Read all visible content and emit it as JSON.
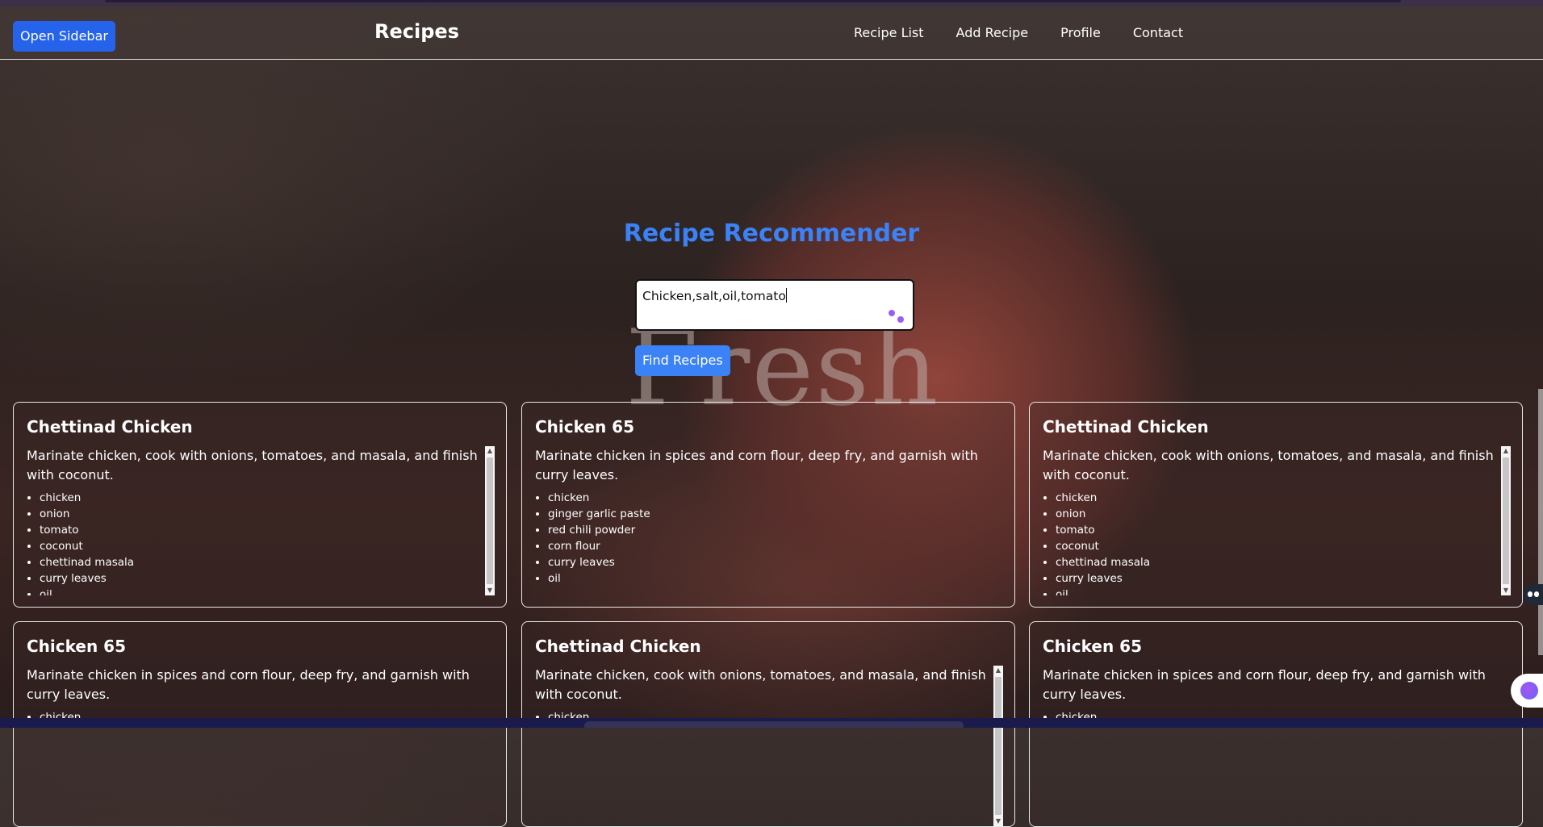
{
  "navbar": {
    "sidebar_button": "Open Sidebar",
    "brand": "Recipes",
    "links": [
      "Recipe List",
      "Add Recipe",
      "Profile",
      "Contact"
    ]
  },
  "hero": {
    "title": "Recipe Recommender",
    "watermark": "Fresh",
    "ingredients_value": "Chicken,salt,oil,tomato",
    "find_button": "Find Recipes"
  },
  "colors": {
    "accent": "#3b82f6",
    "button": "#2563eb"
  },
  "cards": [
    {
      "title": "Chettinad Chicken",
      "description": "Marinate chicken, cook with onions, tomatoes, and masala, and finish with coconut.",
      "ingredients": [
        "chicken",
        "onion",
        "tomato",
        "coconut",
        "chettinad masala",
        "curry leaves",
        "oil"
      ],
      "scrollable": true
    },
    {
      "title": "Chicken 65",
      "description": "Marinate chicken in spices and corn flour, deep fry, and garnish with curry leaves.",
      "ingredients": [
        "chicken",
        "ginger garlic paste",
        "red chili powder",
        "corn flour",
        "curry leaves",
        "oil"
      ],
      "scrollable": false
    },
    {
      "title": "Chettinad Chicken",
      "description": "Marinate chicken, cook with onions, tomatoes, and masala, and finish with coconut.",
      "ingredients": [
        "chicken",
        "onion",
        "tomato",
        "coconut",
        "chettinad masala",
        "curry leaves",
        "oil"
      ],
      "scrollable": true
    },
    {
      "title": "Chicken 65",
      "description": "Marinate chicken in spices and corn flour, deep fry, and garnish with curry leaves.",
      "ingredients": [
        "chicken"
      ],
      "scrollable": false
    },
    {
      "title": "Chettinad Chicken",
      "description": "Marinate chicken, cook with onions, tomatoes, and masala, and finish with coconut.",
      "ingredients": [
        "chicken"
      ],
      "scrollable": true
    },
    {
      "title": "Chicken 65",
      "description": "Marinate chicken in spices and corn flour, deep fry, and garnish with curry leaves.",
      "ingredients": [
        "chicken"
      ],
      "scrollable": false
    }
  ]
}
